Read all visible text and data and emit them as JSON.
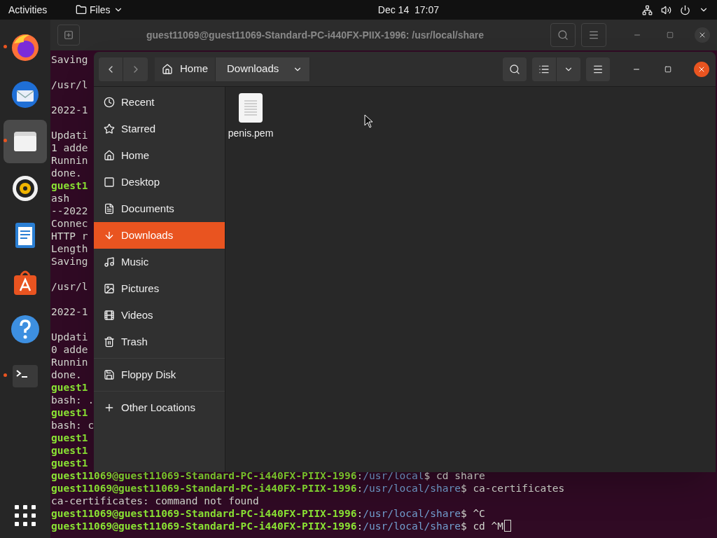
{
  "top_bar": {
    "activities": "Activities",
    "app_menu": "Files",
    "clock": "Dec 14  17:07"
  },
  "dock": [
    {
      "running": true,
      "selected": false
    },
    {
      "running": false,
      "selected": false
    },
    {
      "running": true,
      "selected": true
    },
    {
      "running": false,
      "selected": false
    },
    {
      "running": false,
      "selected": false
    },
    {
      "running": false,
      "selected": false
    },
    {
      "running": false,
      "selected": false
    },
    {
      "running": true,
      "selected": false
    }
  ],
  "terminal": {
    "title": "guest11069@guest11069-Standard-PC-i440FX-PIIX-1996: /usr/local/share",
    "lines": [
      {
        "kind": "output",
        "text": "Saving"
      },
      {
        "kind": "blank"
      },
      {
        "kind": "output",
        "text": "/usr/l"
      },
      {
        "kind": "blank"
      },
      {
        "kind": "output",
        "text": "2022-1"
      },
      {
        "kind": "blank"
      },
      {
        "kind": "output",
        "text": "Updati"
      },
      {
        "kind": "output",
        "text": "1 adde"
      },
      {
        "kind": "output",
        "text": "Runnin"
      },
      {
        "kind": "output",
        "text": "done."
      },
      {
        "kind": "prompt",
        "user": "guest1"
      },
      {
        "kind": "output",
        "text": "ash"
      },
      {
        "kind": "output",
        "text": "--2022"
      },
      {
        "kind": "output",
        "text": "Connec"
      },
      {
        "kind": "output",
        "text": "HTTP r"
      },
      {
        "kind": "output",
        "text": "Length"
      },
      {
        "kind": "output",
        "text": "Saving"
      },
      {
        "kind": "blank"
      },
      {
        "kind": "output",
        "text": "/usr/l"
      },
      {
        "kind": "blank"
      },
      {
        "kind": "output",
        "text": "2022-1"
      },
      {
        "kind": "blank"
      },
      {
        "kind": "output",
        "text": "Updati"
      },
      {
        "kind": "output",
        "text": "0 adde"
      },
      {
        "kind": "output",
        "text": "Runnin"
      },
      {
        "kind": "output",
        "text": "done."
      },
      {
        "kind": "prompt",
        "user": "guest1"
      },
      {
        "kind": "output",
        "text": "bash: ."
      },
      {
        "kind": "prompt",
        "user": "guest1"
      },
      {
        "kind": "output",
        "text": "bash: c"
      },
      {
        "kind": "prompt",
        "user": "guest1"
      },
      {
        "kind": "prompt",
        "user": "guest1"
      },
      {
        "kind": "prompt",
        "user": "guest1"
      },
      {
        "kind": "prompt",
        "user": "guest11069@guest11069-Standard-PC-i440FX-PIIX-1996",
        "sep": ":",
        "path": "/usr/local",
        "command": "$ cd share"
      },
      {
        "kind": "prompt",
        "user": "guest11069@guest11069-Standard-PC-i440FX-PIIX-1996",
        "sep": ":",
        "path": "/usr/local/share",
        "command": "$ ca-certificates"
      },
      {
        "kind": "output",
        "text": "ca-certificates: command not found"
      },
      {
        "kind": "prompt",
        "user": "guest11069@guest11069-Standard-PC-i440FX-PIIX-1996",
        "sep": ":",
        "path": "/usr/local/share",
        "command": "$ ^C"
      },
      {
        "kind": "prompt",
        "user": "guest11069@guest11069-Standard-PC-i440FX-PIIX-1996",
        "sep": ":",
        "path": "/usr/local/share",
        "command": "$ cd ^M",
        "cursor": true
      }
    ]
  },
  "files": {
    "path": [
      {
        "label": "Home",
        "selected": false
      },
      {
        "label": "Downloads",
        "selected": true
      }
    ],
    "sidebar": [
      {
        "items": [
          {
            "label": "Recent",
            "selected": false
          },
          {
            "label": "Starred",
            "selected": false
          },
          {
            "label": "Home",
            "selected": false
          },
          {
            "label": "Desktop",
            "selected": false
          },
          {
            "label": "Documents",
            "selected": false
          },
          {
            "label": "Downloads",
            "selected": true
          },
          {
            "label": "Music",
            "selected": false
          },
          {
            "label": "Pictures",
            "selected": false
          },
          {
            "label": "Videos",
            "selected": false
          },
          {
            "label": "Trash",
            "selected": false
          }
        ]
      },
      {
        "items": [
          {
            "label": "Floppy Disk",
            "selected": false
          }
        ]
      },
      {
        "items": [
          {
            "label": "Other Locations",
            "selected": false
          }
        ]
      }
    ],
    "items": [
      {
        "name": "penis.pem"
      }
    ]
  }
}
